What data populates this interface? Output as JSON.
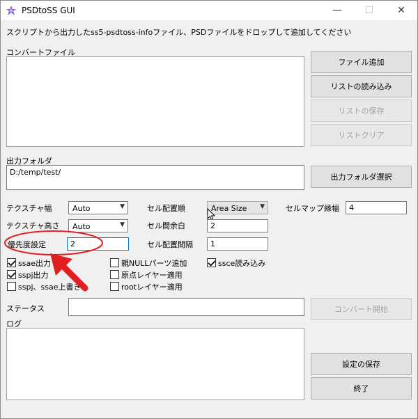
{
  "window": {
    "title": "PSDtoSS GUI",
    "minimize_glyph": "—",
    "maximize_glyph": "☐",
    "close_glyph": "✕"
  },
  "instruction": "スクリプトから出力したss5-psdtoss-infoファイル、PSDファイルをドロップして追加してください",
  "convert_files": {
    "label": "コンバートファイル",
    "buttons": {
      "add_file": "ファイル追加",
      "load_list": "リストの読み込み",
      "save_list": "リストの保存",
      "clear_list": "リストクリア"
    }
  },
  "output_folder": {
    "label": "出力フォルダ",
    "value": "D:/temp/test/",
    "select_button": "出力フォルダ選択"
  },
  "settings": {
    "texture_width": {
      "label": "テクスチャ幅",
      "value": "Auto"
    },
    "texture_height": {
      "label": "テクスチャ高さ",
      "value": "Auto"
    },
    "priority": {
      "label": "優先度設定",
      "value": "2"
    },
    "cell_order": {
      "label": "セル配置順",
      "value": "Area Size"
    },
    "cell_margin": {
      "label": "セル間余白",
      "value": "2"
    },
    "cell_spacing": {
      "label": "セル配置間隔",
      "value": "1"
    },
    "cellmap_border": {
      "label": "セルマップ縁幅",
      "value": "4"
    }
  },
  "checkboxes": {
    "ssae_output": {
      "label": "ssae出力",
      "checked": true
    },
    "sspj_output": {
      "label": "sspj出力",
      "checked": true
    },
    "overwrite": {
      "label": "sspj、ssae上書き",
      "checked": false
    },
    "parent_null": {
      "label": "親NULLパーツ追加",
      "checked": false
    },
    "origin_layer": {
      "label": "原点レイヤー適用",
      "checked": false
    },
    "root_layer": {
      "label": "rootレイヤー適用",
      "checked": false
    },
    "ssce_read": {
      "label": "ssce読み込み",
      "checked": true
    }
  },
  "status": {
    "label": "ステータス",
    "value": "",
    "convert_button": "コンバート開始"
  },
  "log": {
    "label": "ログ"
  },
  "footer": {
    "save_settings": "設定の保存",
    "exit": "終了"
  },
  "annotation": {
    "color": "#e02020"
  }
}
